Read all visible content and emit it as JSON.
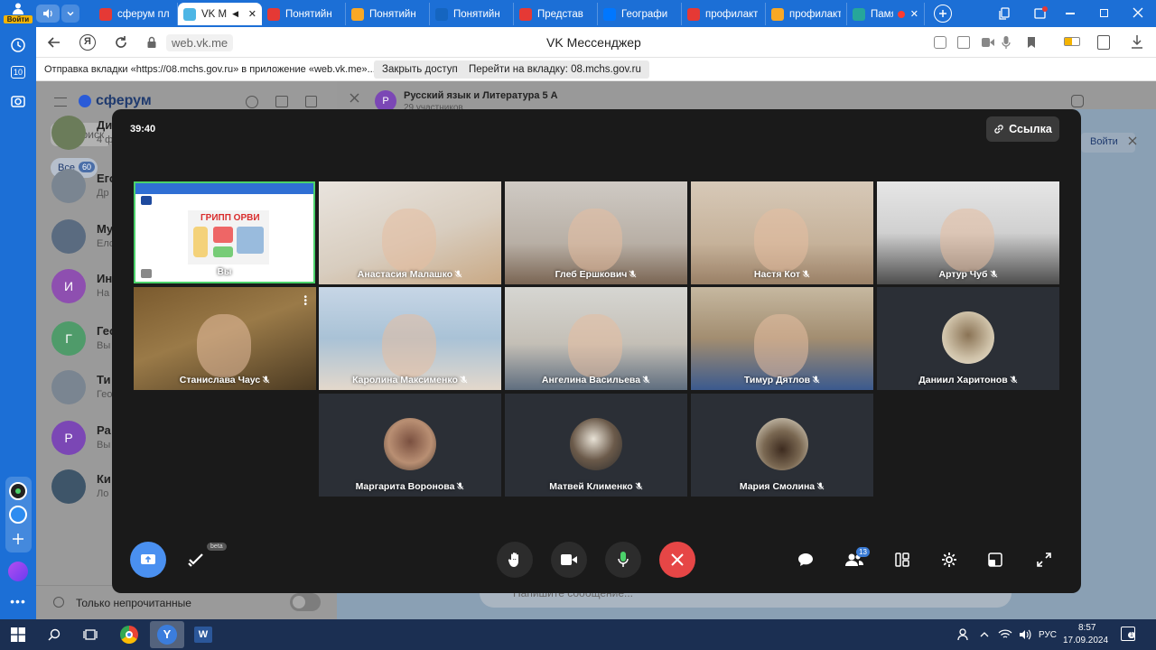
{
  "browser": {
    "profile_label": "Войти",
    "tabs": [
      {
        "title": "сферум пл",
        "favicon": "yandex-icon",
        "color": "#e53935"
      },
      {
        "title": "VK M",
        "favicon": "vk-messenger-icon",
        "color": "#4db6e5",
        "active": true
      },
      {
        "title": "Понятийн",
        "favicon": "yandex-icon",
        "color": "#e53935"
      },
      {
        "title": "Понятийн",
        "favicon": "image-icon",
        "color": "#f9a825"
      },
      {
        "title": "Понятийн",
        "favicon": "doc-icon",
        "color": "#1565c0"
      },
      {
        "title": "Представ",
        "favicon": "yandex-icon",
        "color": "#e53935"
      },
      {
        "title": "Географи",
        "favicon": "vk-icon",
        "color": "#0077ff"
      },
      {
        "title": "профилакт",
        "favicon": "yandex-icon",
        "color": "#e53935"
      },
      {
        "title": "профилакт",
        "favicon": "image-icon",
        "color": "#f9a825"
      },
      {
        "title": "Памя",
        "favicon": "site-icon",
        "color": "#26a69a"
      }
    ],
    "url": "web.vk.me",
    "page_title": "VK Мессенджер"
  },
  "infobar": {
    "message": "Отправка вкладки «https://08.mchs.gov.ru» в приложение «web.vk.me»...",
    "close_access": "Закрыть доступ",
    "goto_tab": "Перейти на вкладку: 08.mchs.gov.ru"
  },
  "sidebar_badges": {
    "tabs_count": "10"
  },
  "messenger": {
    "brand": "сферум",
    "search_placeholder": "Поиск",
    "filter_all": "Все",
    "filter_count": "60",
    "unread_only": "Только непрочитанные",
    "chat_title": "Русский язык и Литература 5 А",
    "chat_sub": "29 участников",
    "join_label": "Войти",
    "message_placeholder": "Напишите сообщение...",
    "chats": [
      {
        "letter": "",
        "name": "Ди",
        "preview": "4 ф",
        "color": "#6b7c5a"
      },
      {
        "letter": "",
        "name": "Его",
        "preview": "Др",
        "color": "#7a8591"
      },
      {
        "letter": "",
        "name": "Му",
        "preview": "Ело",
        "color": "#5a6b80"
      },
      {
        "letter": "И",
        "name": "Ин",
        "preview": "На",
        "color": "#8e4fb0"
      },
      {
        "letter": "Г",
        "name": "Гео",
        "preview": "Вы",
        "color": "#4f9b6a"
      },
      {
        "letter": "",
        "name": "Ти",
        "preview": "Гео",
        "color": "#7a8591"
      },
      {
        "letter": "Р",
        "name": "Ра",
        "preview": "Вы",
        "color": "#7b47b5"
      },
      {
        "letter": "",
        "name": "Ки",
        "preview": "Ло",
        "color": "#3e5569"
      }
    ]
  },
  "call": {
    "timer": "39:40",
    "link_label": "Ссылка",
    "beta_label": "beta",
    "participants_count": "13",
    "self_label": "Вы",
    "participants": [
      {
        "name": "Анастасия Малашко",
        "kind": "video"
      },
      {
        "name": "Глеб Ершкович",
        "kind": "video"
      },
      {
        "name": "Настя Кот",
        "kind": "video"
      },
      {
        "name": "Артур Чуб",
        "kind": "video"
      },
      {
        "name": "Станислава Чаус",
        "kind": "video"
      },
      {
        "name": "Каролина Максименко",
        "kind": "video"
      },
      {
        "name": "Ангелина Васильева",
        "kind": "video"
      },
      {
        "name": "Тимур Дятлов",
        "kind": "video"
      },
      {
        "name": "Даниил Харитонов",
        "kind": "avatar"
      },
      {
        "name": "Маргарита Воронова",
        "kind": "avatar"
      },
      {
        "name": "Матвей Клименко",
        "kind": "avatar"
      },
      {
        "name": "Мария Смолина",
        "kind": "avatar"
      }
    ],
    "shared_screen_text": "ГРИПП ОРВИ"
  },
  "taskbar": {
    "language": "РУС",
    "time": "8:57",
    "date": "17.09.2024",
    "notifications": "1"
  },
  "colors": {
    "browser_blue": "#1c6fd6",
    "call_bg": "#1a1a1a",
    "hangup_red": "#e64646",
    "share_blue": "#4a90f0",
    "active_speaker_green": "#4bd16a"
  }
}
